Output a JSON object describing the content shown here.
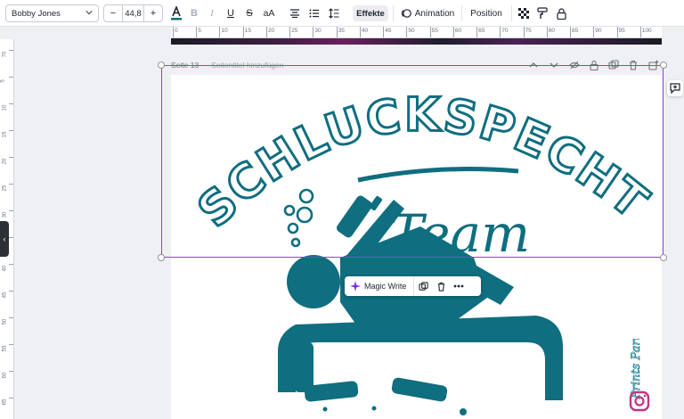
{
  "toolbar": {
    "font_family": "Bobby Jones",
    "font_size": "44,8",
    "decrease": "−",
    "increase": "+",
    "letter_case": "aA",
    "effects": "Effekte",
    "animation": "Animation",
    "position": "Position"
  },
  "ruler": {
    "top_ticks": [
      "0",
      "5",
      "10",
      "15",
      "20",
      "25",
      "30",
      "35",
      "40",
      "45",
      "50",
      "55",
      "60",
      "65",
      "70",
      "75",
      "80",
      "85",
      "90",
      "95",
      "100"
    ],
    "left_ticks": [
      "70",
      "5",
      "10",
      "15",
      "20",
      "25",
      "30",
      "35",
      "40",
      "45",
      "50",
      "55",
      "60",
      "65"
    ]
  },
  "page_header": {
    "title": "Seite 13",
    "subtitle": "- Seitentitel hinzufügen"
  },
  "design": {
    "headline": "SCHLUCKSPECHT",
    "script_word": "Team",
    "teal_color": "#0f6e7f"
  },
  "magic_bar": {
    "label": "Magic Write"
  },
  "watermark": {
    "text": "Prints Party"
  },
  "colors": {
    "selection": "#8b3dff",
    "accent": "#0f6e7f"
  }
}
